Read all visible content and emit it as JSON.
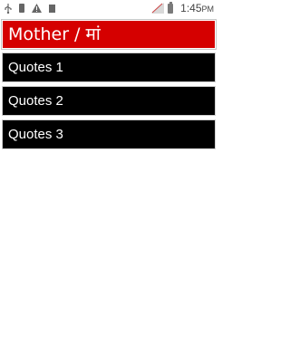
{
  "status_bar": {
    "time": "1:45",
    "time_suffix": "PM",
    "icons": [
      "usb-icon",
      "sd-card-icon",
      "warning-icon",
      "file-icon",
      "signal-icon",
      "battery-icon"
    ]
  },
  "header": {
    "title": "Mother / मां",
    "background_color": "#d50000"
  },
  "list": {
    "items": [
      {
        "label": "Quotes 1"
      },
      {
        "label": "Quotes 2"
      },
      {
        "label": "Quotes 3"
      }
    ]
  }
}
